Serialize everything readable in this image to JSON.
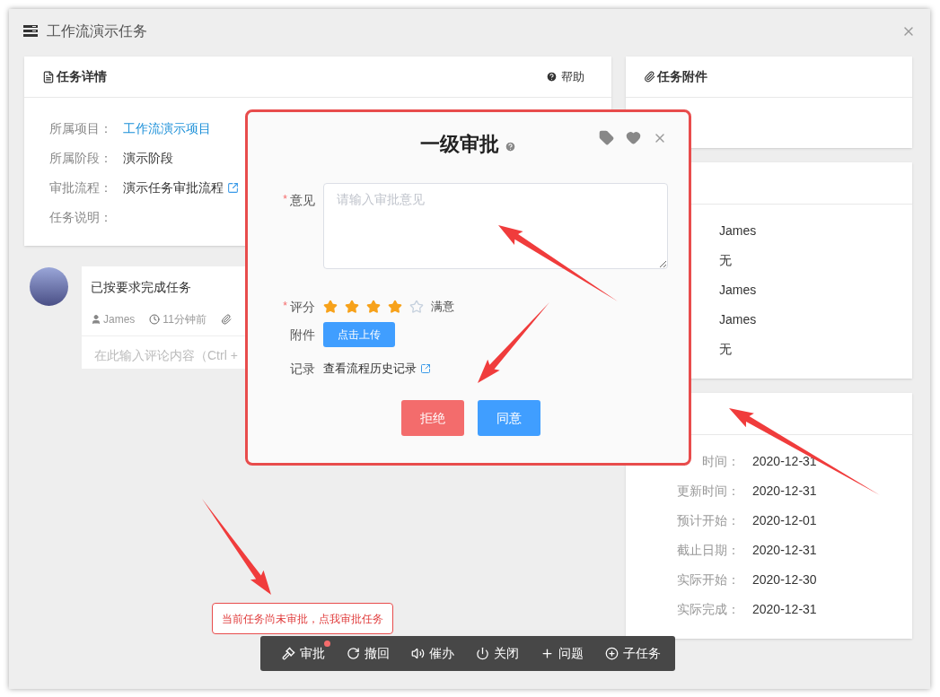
{
  "window": {
    "title": "工作流演示任务"
  },
  "task_details": {
    "title": "任务详情",
    "help": "帮助",
    "fields": [
      {
        "label": "所属项目：",
        "value": "工作流演示项目",
        "kind": "link"
      },
      {
        "label": "所属阶段：",
        "value": "演示阶段",
        "kind": "text"
      },
      {
        "label": "审批流程：",
        "value": "演示任务审批流程",
        "kind": "external"
      },
      {
        "label": "任务说明：",
        "kind": "empty"
      }
    ]
  },
  "comment": {
    "text": "已按要求完成任务",
    "author": "James",
    "time": "11分钟前",
    "input_placeholder": "在此输入评论内容（Ctrl +"
  },
  "attachments_card": {
    "title": "任务附件"
  },
  "people_card": {
    "values": [
      "James",
      "无",
      "James",
      "James",
      "无"
    ]
  },
  "dates_card": {
    "rows": [
      {
        "label": "时间：",
        "value": "2020-12-31"
      },
      {
        "label": "更新时间：",
        "value": "2020-12-31"
      },
      {
        "label": "预计开始：",
        "value": "2020-12-01"
      },
      {
        "label": "截止日期：",
        "value": "2020-12-31"
      },
      {
        "label": "实际开始：",
        "value": "2020-12-30"
      },
      {
        "label": "实际完成：",
        "value": "2020-12-31"
      }
    ]
  },
  "dialog": {
    "title": "一级审批",
    "opinion": {
      "label": "意见",
      "required": true,
      "required_mark": "*",
      "placeholder": "请输入审批意见"
    },
    "rating": {
      "label": "评分",
      "required": true,
      "required_mark": "*",
      "stars": 4,
      "text": "满意"
    },
    "attachment": {
      "label": "附件",
      "button": "点击上传"
    },
    "record": {
      "label": "记录",
      "link": "查看流程历史记录"
    },
    "buttons": [
      {
        "label": "拒绝",
        "kind": "danger"
      },
      {
        "label": "同意",
        "kind": "primary"
      }
    ]
  },
  "tooltip": {
    "text": "当前任务尚未审批，点我审批任务"
  },
  "toolbar": [
    {
      "label": "审批",
      "kind": "gavel",
      "badge": true
    },
    {
      "label": "撤回",
      "kind": "redo",
      "badge": false
    },
    {
      "label": "催办",
      "kind": "volume",
      "badge": false
    },
    {
      "label": "关闭",
      "kind": "power",
      "badge": false
    },
    {
      "label": "问题",
      "kind": "plus",
      "badge": false
    },
    {
      "label": "子任务",
      "kind": "plus-circle",
      "badge": false
    }
  ]
}
